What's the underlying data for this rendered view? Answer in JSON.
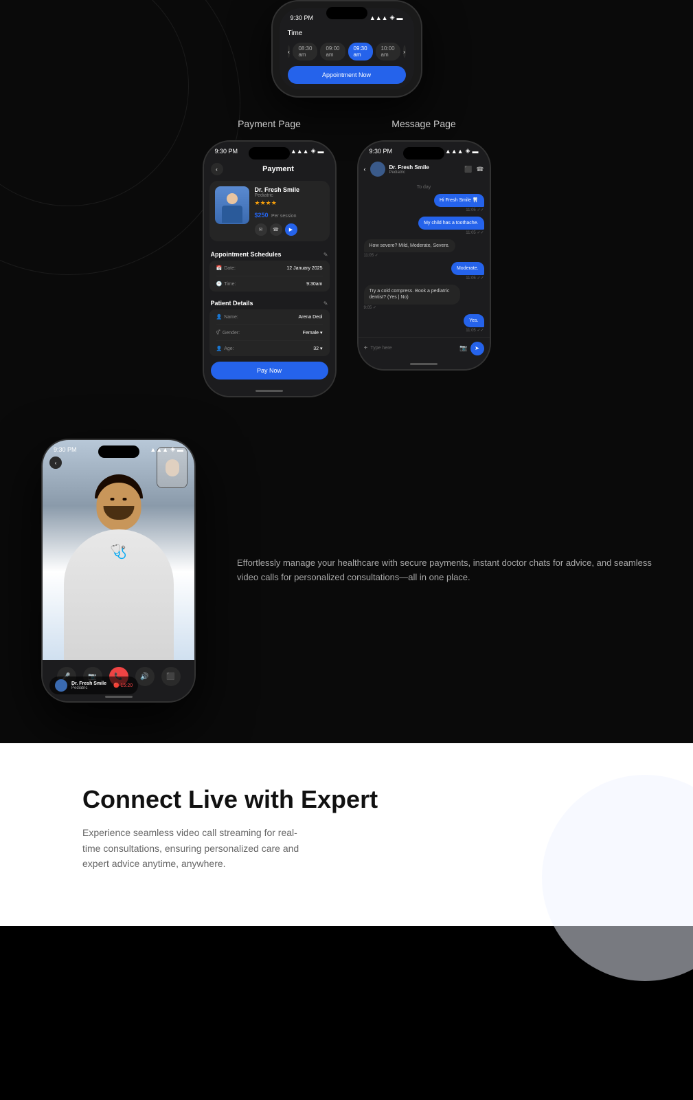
{
  "top_phone": {
    "status_time": "9:30 PM",
    "time_label": "Time",
    "nav_prev": "‹",
    "nav_next": "›",
    "slots": [
      "08:30 am",
      "09:00 am",
      "09:30 am",
      "10:00 am"
    ],
    "active_slot_index": 2,
    "appointment_btn": "Appointment Now"
  },
  "payment_section": {
    "label": "Payment Page",
    "status_time": "9:30 PM",
    "back": "‹",
    "title": "Payment",
    "doctor_name": "Dr. Fresh Smile",
    "doctor_specialty": "Pediatric",
    "stars": "★★★★",
    "price": "$250",
    "per_session": "Per session",
    "appt_section_title": "Appointment Schedules",
    "date_label": "Date:",
    "date_value": "12 January 2025",
    "time_label": "Time:",
    "time_value": "9:30am",
    "patient_section_title": "Patient Details",
    "name_label": "Name:",
    "name_value": "Arena Deol",
    "gender_label": "Gender:",
    "gender_value": "Female",
    "age_label": "Age:",
    "age_value": "32",
    "pay_btn": "Pay Now"
  },
  "message_section": {
    "label": "Message Page",
    "status_time": "9:30 PM",
    "back": "‹",
    "doctor_name": "Dr. Fresh Smile",
    "doctor_specialty": "Pediatric",
    "date_divider": "To day",
    "messages": [
      {
        "text": "Hi Fresh Smile 🦷",
        "side": "right",
        "time": "11:05"
      },
      {
        "text": "My child has a toothache.",
        "side": "right",
        "time": "11:05"
      },
      {
        "text": "How severe? Mild, Moderate, Severe.",
        "side": "left",
        "time": "11:05"
      },
      {
        "text": "Moderate.",
        "side": "right",
        "time": "11:05"
      },
      {
        "text": "Try a cold compress. Book a pediatric dentist? (Yes | No)",
        "side": "left",
        "time": "9:05"
      },
      {
        "text": "Yes.",
        "side": "right",
        "time": "11:05"
      }
    ],
    "input_placeholder": "Type here"
  },
  "description_text": "Effortlessly manage your healthcare with secure payments, instant doctor chats for advice, and seamless video calls for personalized consultations—all in one place.",
  "video_section": {
    "doctor_name": "Dr. Fresh Smile",
    "doctor_specialty": "Pediatric",
    "timer": "🔴 15:20",
    "status_time": "9:30 PM"
  },
  "connect_section": {
    "title": "Connect Live with Expert",
    "description": "Experience seamless video call streaming for real-time consultations, ensuring personalized care and expert advice anytime, anywhere."
  }
}
